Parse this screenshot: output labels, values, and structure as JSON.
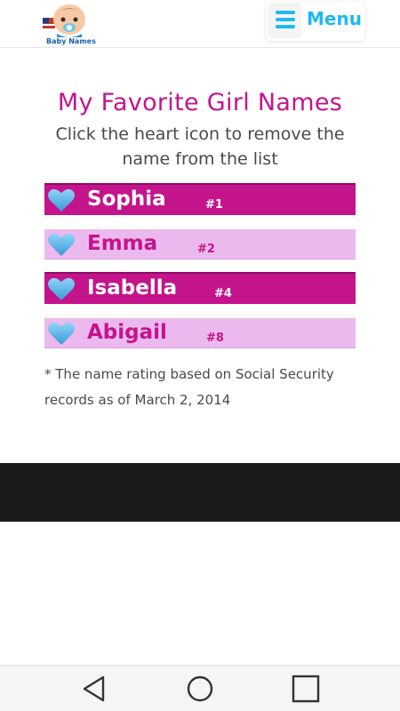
{
  "header": {
    "logo_caption": "Baby Names",
    "menu_label": "Menu"
  },
  "main": {
    "title": "My Favorite Girl Names",
    "subtitle": "Click the heart icon to remove the name from the list",
    "names": [
      {
        "name": "Sophia",
        "rank": "#1"
      },
      {
        "name": "Emma",
        "rank": "#2"
      },
      {
        "name": "Isabella",
        "rank": "#4"
      },
      {
        "name": "Abigail",
        "rank": "#8"
      }
    ],
    "footnote": "* The name rating based on Social Security records as of March 2, 2014"
  },
  "icons": {
    "remove_favorite": "heart-icon",
    "menu": "hamburger-icon",
    "back": "back-triangle-icon",
    "home": "home-circle-icon",
    "recents": "recents-square-icon"
  },
  "colors": {
    "accent_pink": "#c4148c",
    "light_pink": "#ecb9ee",
    "menu_blue": "#1fb8f0",
    "heart_blue": "#5ab4e8"
  }
}
